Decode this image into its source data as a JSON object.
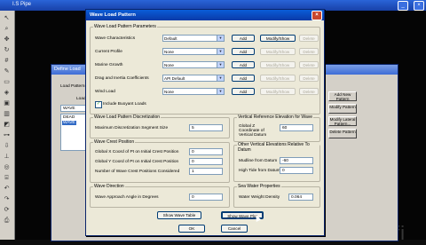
{
  "app": {
    "title": "I.S Pipe"
  },
  "bg_dialog": {
    "title": "Define Load",
    "group": "Load Patterns",
    "load_label": "Load",
    "input_value": "WAVE",
    "list_items": [
      "DEAD",
      "WAVE"
    ],
    "right_buttons": [
      "Add New Pattern",
      "Modify Pattern",
      "Modify Lateral Pattern...",
      "Delete Pattern"
    ]
  },
  "dialog": {
    "title": "Wave Load Pattern",
    "params_group": "Wave Load Pattern Parameters",
    "params": [
      {
        "label": "Wave Characteristics",
        "value": "Default"
      },
      {
        "label": "Current Profile",
        "value": "None"
      },
      {
        "label": "Marine Growth",
        "value": "None"
      },
      {
        "label": "Drag and Inertia Coefficients",
        "value": "API Default"
      },
      {
        "label": "Wind Load",
        "value": "None"
      }
    ],
    "add_label": "Add",
    "modify_label": "Modify/Show",
    "delete_label": "Delete",
    "buoyant_label": "Include Buoyant Loads",
    "disc_group": "Wave Load Pattern Discretization",
    "disc_label": "Maximum Discretization Segment Size",
    "disc_value": "5",
    "crest_group": "Wave Crest Position",
    "crest_rows": [
      {
        "label": "Global X Coord of Pt on Initial Crest Position",
        "value": "0"
      },
      {
        "label": "Global Y Coord of Pt on Initial Crest Position",
        "value": "0"
      },
      {
        "label": "Number of Wave Crest Positions Considered",
        "value": "1"
      }
    ],
    "dir_group": "Wave Direction",
    "dir_label": "Wave Approach Angle in Degrees",
    "dir_value": "0",
    "vref_group": "Vertical Reference Elevation for Wave",
    "vref_label": "Global Z Coordinate of Vertical Datum",
    "vref_value": "60",
    "other_group": "Other Vertical Elevations Relative To Datum",
    "other_rows": [
      {
        "label": "Mudline from Datum",
        "value": "-60"
      },
      {
        "label": "High Tide from Datum",
        "value": "0"
      }
    ],
    "sea_group": "Sea Water Properties",
    "sea_label": "Water Weight Density",
    "sea_value": "0.064",
    "show_table_label": "Show Wave Table",
    "show_plot_label": "Show Wave Plot",
    "ok_label": "OK",
    "cancel_label": "Cancel"
  },
  "colors": {
    "titlebar": "#0a4fc8",
    "dialog_bg": "#ece9d8"
  }
}
